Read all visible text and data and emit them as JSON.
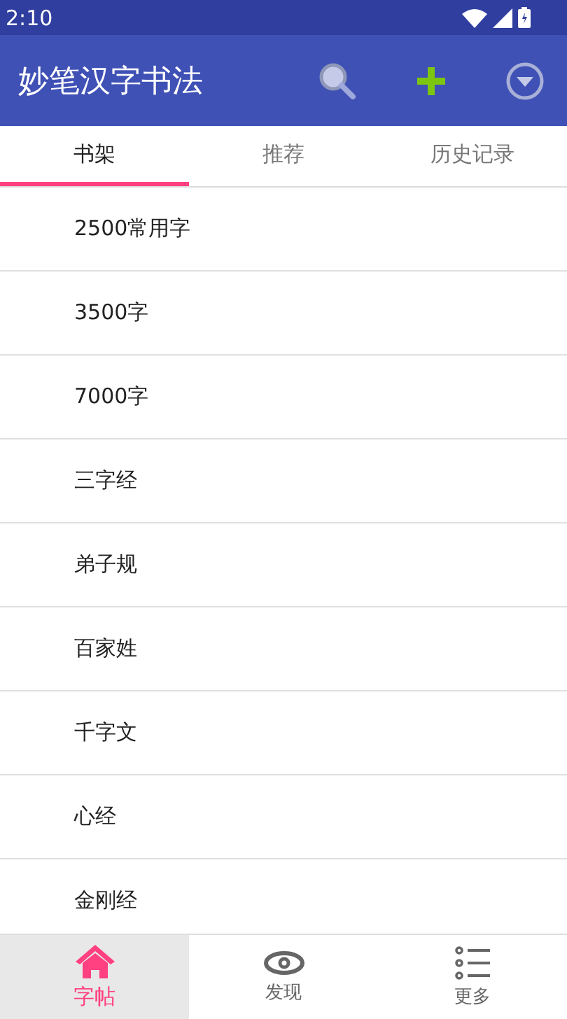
{
  "status_bar": {
    "time": "2:10"
  },
  "app_bar": {
    "title": "妙笔汉字书法"
  },
  "tabs": [
    {
      "label": "书架",
      "selected": true
    },
    {
      "label": "推荐",
      "selected": false
    },
    {
      "label": "历史记录",
      "selected": false
    }
  ],
  "books": [
    "2500常用字",
    "3500字",
    "7000字",
    "三字经",
    "弟子规",
    "百家姓",
    "千字文",
    "心经",
    "金刚经"
  ],
  "bottom_nav": [
    {
      "label": "字帖",
      "kind": "home",
      "selected": true
    },
    {
      "label": "发现",
      "kind": "eye",
      "selected": false
    },
    {
      "label": "更多",
      "kind": "list",
      "selected": false
    }
  ]
}
